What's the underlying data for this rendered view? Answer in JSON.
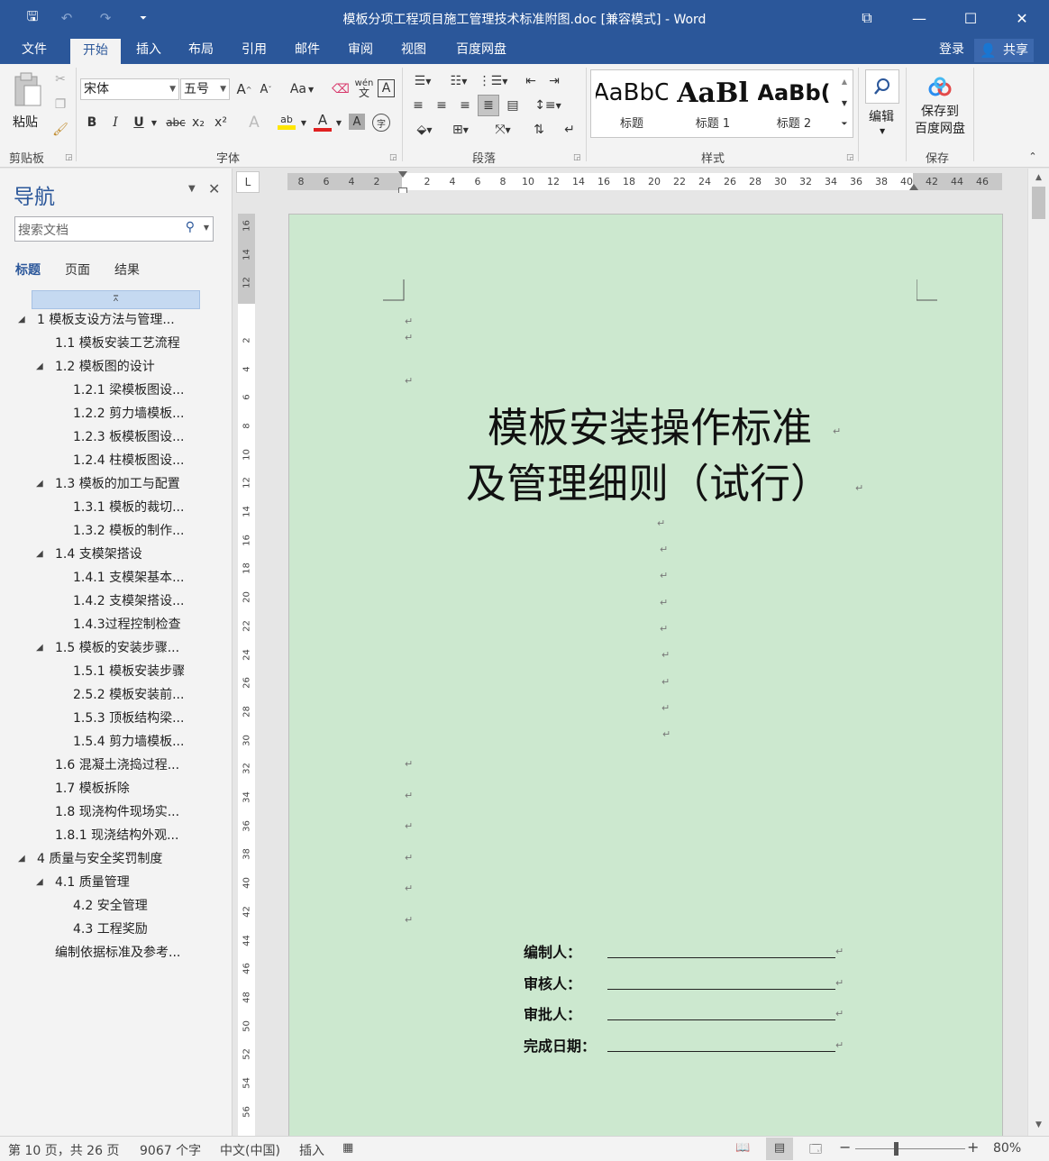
{
  "titlebar": {
    "title": "模板分项工程项目施工管理技术标准附图.doc [兼容模式] - Word",
    "save_glyph": "🖫",
    "undo_glyph": "↶",
    "redo_glyph": "↷",
    "customize_glyph": "⏷",
    "ribbon_opts_glyph": "⧉",
    "minimize_glyph": "—",
    "maximize_glyph": "☐",
    "close_glyph": "✕"
  },
  "tabs": {
    "items": [
      "文件",
      "开始",
      "插入",
      "布局",
      "引用",
      "邮件",
      "审阅",
      "视图",
      "百度网盘"
    ],
    "active": "开始",
    "login": "登录",
    "share": "共享",
    "share_glyph": "👤"
  },
  "ribbon": {
    "clipboard": {
      "label": "剪贴板",
      "paste": "粘贴"
    },
    "font": {
      "label": "字体",
      "font_name": "宋体",
      "font_size": "五号",
      "grow": "A",
      "shrink": "A",
      "case": "Aa",
      "bold": "B",
      "italic": "I",
      "underline": "U",
      "strike": "abc",
      "sub": "x₂",
      "sup": "x²",
      "effects": "A",
      "highlight": "ab",
      "color": "A",
      "shade": "A",
      "pinyin": "wén",
      "border": "A",
      "enclose": "字"
    },
    "paragraph": {
      "label": "段落"
    },
    "styles": {
      "label": "样式",
      "items": [
        {
          "preview": "AaBbC",
          "name": "标题"
        },
        {
          "preview": "AaBl",
          "name": "标题 1"
        },
        {
          "preview": "AaBb(",
          "name": "标题 2"
        }
      ]
    },
    "editing": {
      "label": "编辑"
    },
    "save": {
      "label": "保存",
      "btn_line1": "保存到",
      "btn_line2": "百度网盘"
    }
  },
  "nav": {
    "title": "导航",
    "search_placeholder": "搜索文档",
    "tabs": [
      "标题",
      "页面",
      "结果"
    ],
    "active_tab": "标题",
    "headings": [
      {
        "text": "1  模板支设方法与管理...",
        "level": 1,
        "expanded": true
      },
      {
        "text": "1.1  模板安装工艺流程",
        "level": 2,
        "expanded": false
      },
      {
        "text": "1.2  模板图的设计",
        "level": 2,
        "expanded": true
      },
      {
        "text": "1.2.1 梁模板图设...",
        "level": 3,
        "expanded": false
      },
      {
        "text": "1.2.2 剪力墙模板...",
        "level": 3,
        "expanded": false
      },
      {
        "text": "1.2.3 板模板图设...",
        "level": 3,
        "expanded": false
      },
      {
        "text": "1.2.4 柱模板图设...",
        "level": 3,
        "expanded": false
      },
      {
        "text": "1.3  模板的加工与配置",
        "level": 2,
        "expanded": true
      },
      {
        "text": "1.3.1  模板的裁切...",
        "level": 3,
        "expanded": false
      },
      {
        "text": "1.3.2  模板的制作...",
        "level": 3,
        "expanded": false
      },
      {
        "text": "1.4 支模架搭设",
        "level": 2,
        "expanded": true
      },
      {
        "text": "1.4.1 支模架基本...",
        "level": 3,
        "expanded": false
      },
      {
        "text": "1.4.2 支模架搭设...",
        "level": 3,
        "expanded": false
      },
      {
        "text": "1.4.3过程控制检查",
        "level": 3,
        "expanded": false
      },
      {
        "text": "1.5  模板的安装步骤...",
        "level": 2,
        "expanded": true
      },
      {
        "text": "1.5.1  模板安装步骤",
        "level": 3,
        "expanded": false
      },
      {
        "text": "2.5.2  模板安装前...",
        "level": 3,
        "expanded": false
      },
      {
        "text": "1.5.3 顶板结构梁...",
        "level": 3,
        "expanded": false
      },
      {
        "text": "1.5.4 剪力墙模板...",
        "level": 3,
        "expanded": false
      },
      {
        "text": "1.6 混凝土浇捣过程...",
        "level": 2,
        "expanded": false
      },
      {
        "text": "1.7 模板拆除",
        "level": 2,
        "expanded": false
      },
      {
        "text": "1.8 现浇构件现场实...",
        "level": 2,
        "expanded": false
      },
      {
        "text": "1.8.1  现浇结构外观...",
        "level": 2,
        "expanded": false
      },
      {
        "text": "4  质量与安全奖罚制度",
        "level": 1,
        "expanded": true
      },
      {
        "text": "4.1 质量管理",
        "level": 2,
        "expanded": true
      },
      {
        "text": "4.2 安全管理",
        "level": 3,
        "expanded": false
      },
      {
        "text": "4.3 工程奖励",
        "level": 3,
        "expanded": false
      },
      {
        "text": "编制依据标准及参考...",
        "level": 2,
        "expanded": false
      }
    ]
  },
  "ruler": {
    "corner": "L",
    "h_ticks": [
      "8",
      "6",
      "4",
      "2",
      "2",
      "4",
      "6",
      "8",
      "10",
      "12",
      "14",
      "16",
      "18",
      "20",
      "22",
      "24",
      "26",
      "28",
      "30",
      "32",
      "34",
      "36",
      "38",
      "40",
      "42",
      "44",
      "46"
    ],
    "v_ticks": [
      "16",
      "14",
      "12",
      "",
      "2",
      "4",
      "6",
      "8",
      "10",
      "12",
      "14",
      "16",
      "18",
      "20",
      "22",
      "24",
      "26",
      "28",
      "30",
      "32",
      "34",
      "36",
      "38",
      "40",
      "42",
      "44",
      "46",
      "48",
      "50",
      "52",
      "54",
      "56"
    ]
  },
  "document": {
    "title_line1": "模板安装操作标准",
    "title_line2": "及管理细则（试行）",
    "para_mark": "↵",
    "signatures": [
      {
        "label": "编制人："
      },
      {
        "label": "审核人："
      },
      {
        "label": "审批人："
      },
      {
        "label": "完成日期："
      }
    ]
  },
  "statusbar": {
    "page": "第 10 页，共 26 页",
    "words": "9067 个字",
    "language": "中文(中国)",
    "mode": "插入",
    "zoom": "80%",
    "zoom_minus": "−",
    "zoom_plus": "+"
  }
}
